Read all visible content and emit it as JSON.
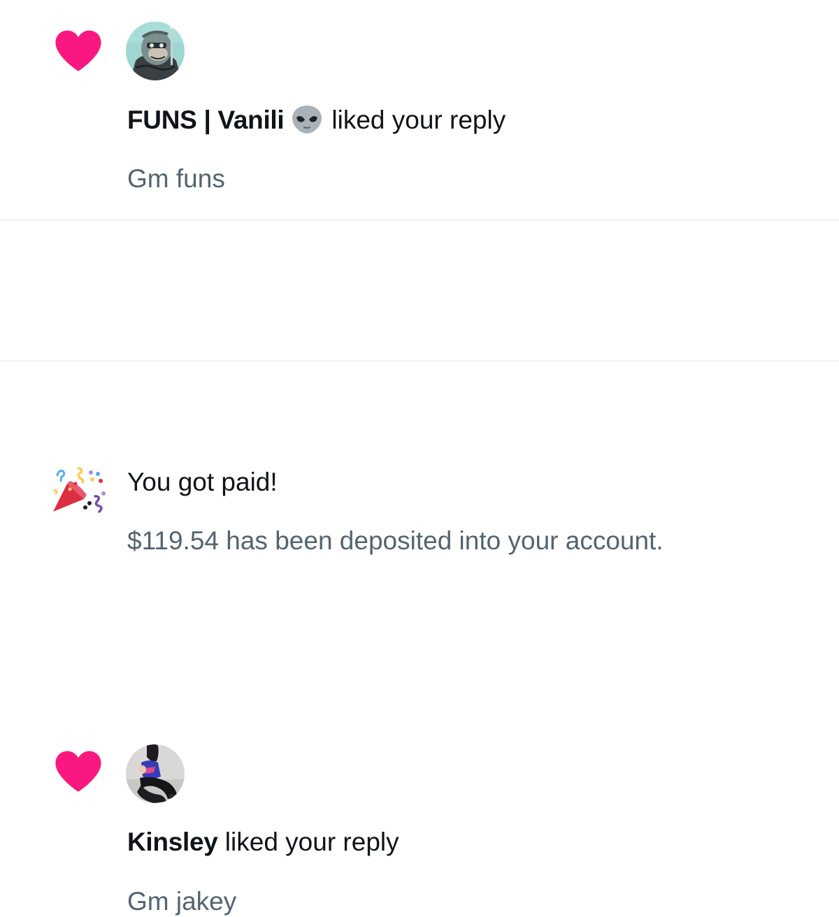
{
  "colors": {
    "like_heart": "#f91880",
    "primary_text": "#0f1419",
    "secondary_text": "#536471",
    "divider": "#eff3f4"
  },
  "notifications": [
    {
      "type": "like",
      "type_icon": "heart-icon",
      "actor_name": "FUNS | Vanili",
      "actor_name_emoji": "alien-emoji-icon",
      "action": "liked your reply",
      "snippet": "Gm funs"
    },
    {
      "type": "payout",
      "type_icon": "party-popper-icon",
      "title": "You got paid!",
      "body": "$119.54 has been deposited into your account."
    },
    {
      "type": "like",
      "type_icon": "heart-icon",
      "actor_name": "Kinsley",
      "action": "liked your reply",
      "snippet": "Gm jakey"
    }
  ]
}
